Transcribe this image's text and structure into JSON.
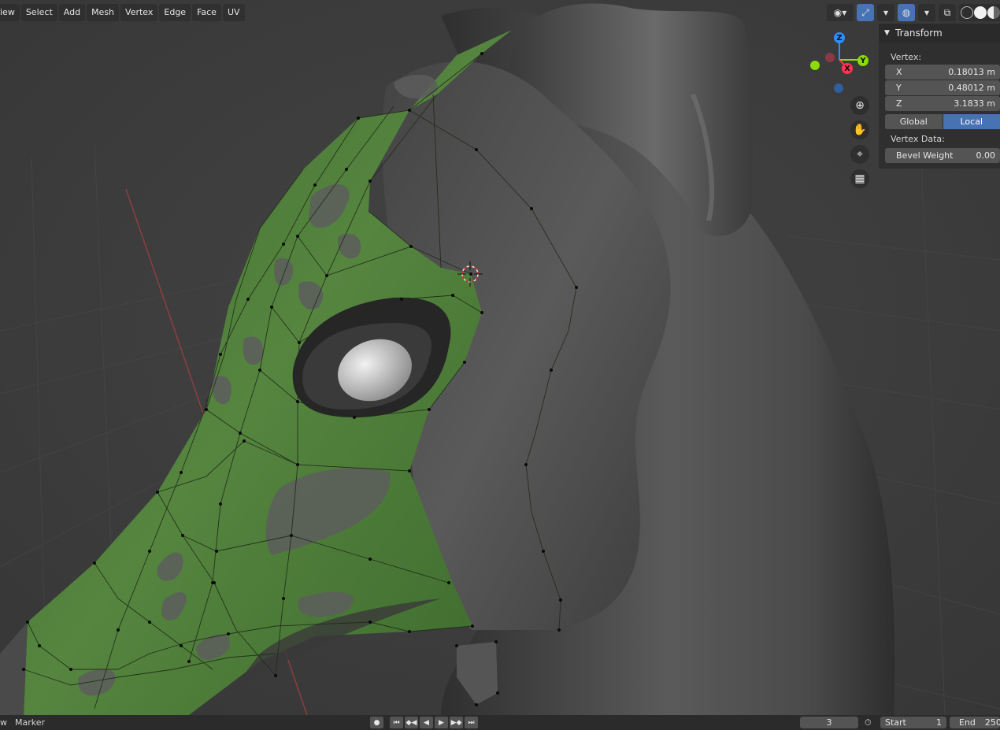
{
  "menu": {
    "items": [
      "iew",
      "Select",
      "Add",
      "Mesh",
      "Vertex",
      "Edge",
      "Face",
      "UV"
    ]
  },
  "header_icons": [
    "visibility-icon",
    "gizmo-icon",
    "overlay-icon",
    "xray-icon",
    "wireframe-shading-icon",
    "solid-shading-icon",
    "material-shading-icon",
    "rendered-shading-icon"
  ],
  "gizmo": {
    "z": "Z",
    "y": "Y",
    "x": "X"
  },
  "nav_icons": [
    "zoom-icon",
    "hand-pan-icon",
    "camera-icon",
    "grid-perspective-icon"
  ],
  "transform_panel": {
    "title": "Transform",
    "vertex_label": "Vertex:",
    "fields": [
      {
        "label": "X",
        "value": "0.18013 m"
      },
      {
        "label": "Y",
        "value": "0.48012 m"
      },
      {
        "label": "Z",
        "value": "3.1833 m"
      }
    ],
    "toggle": {
      "global": "Global",
      "local": "Local",
      "selected": "Local"
    },
    "vertex_data_label": "Vertex Data:",
    "bevel": {
      "label": "Bevel Weight",
      "value": "0.00"
    }
  },
  "timeline": {
    "view_label": "w",
    "marker_label": "Marker",
    "current_frame": "3",
    "start_label": "Start",
    "start_value": "1",
    "end_label": "End",
    "end_value": "250"
  },
  "colors": {
    "selection_green": "#4a7a35",
    "mesh_gray": "#4d4d4d",
    "accent_blue": "#4772b3",
    "axis_x": "#ff3352",
    "axis_y": "#8bdc00",
    "axis_z": "#2890ff"
  }
}
